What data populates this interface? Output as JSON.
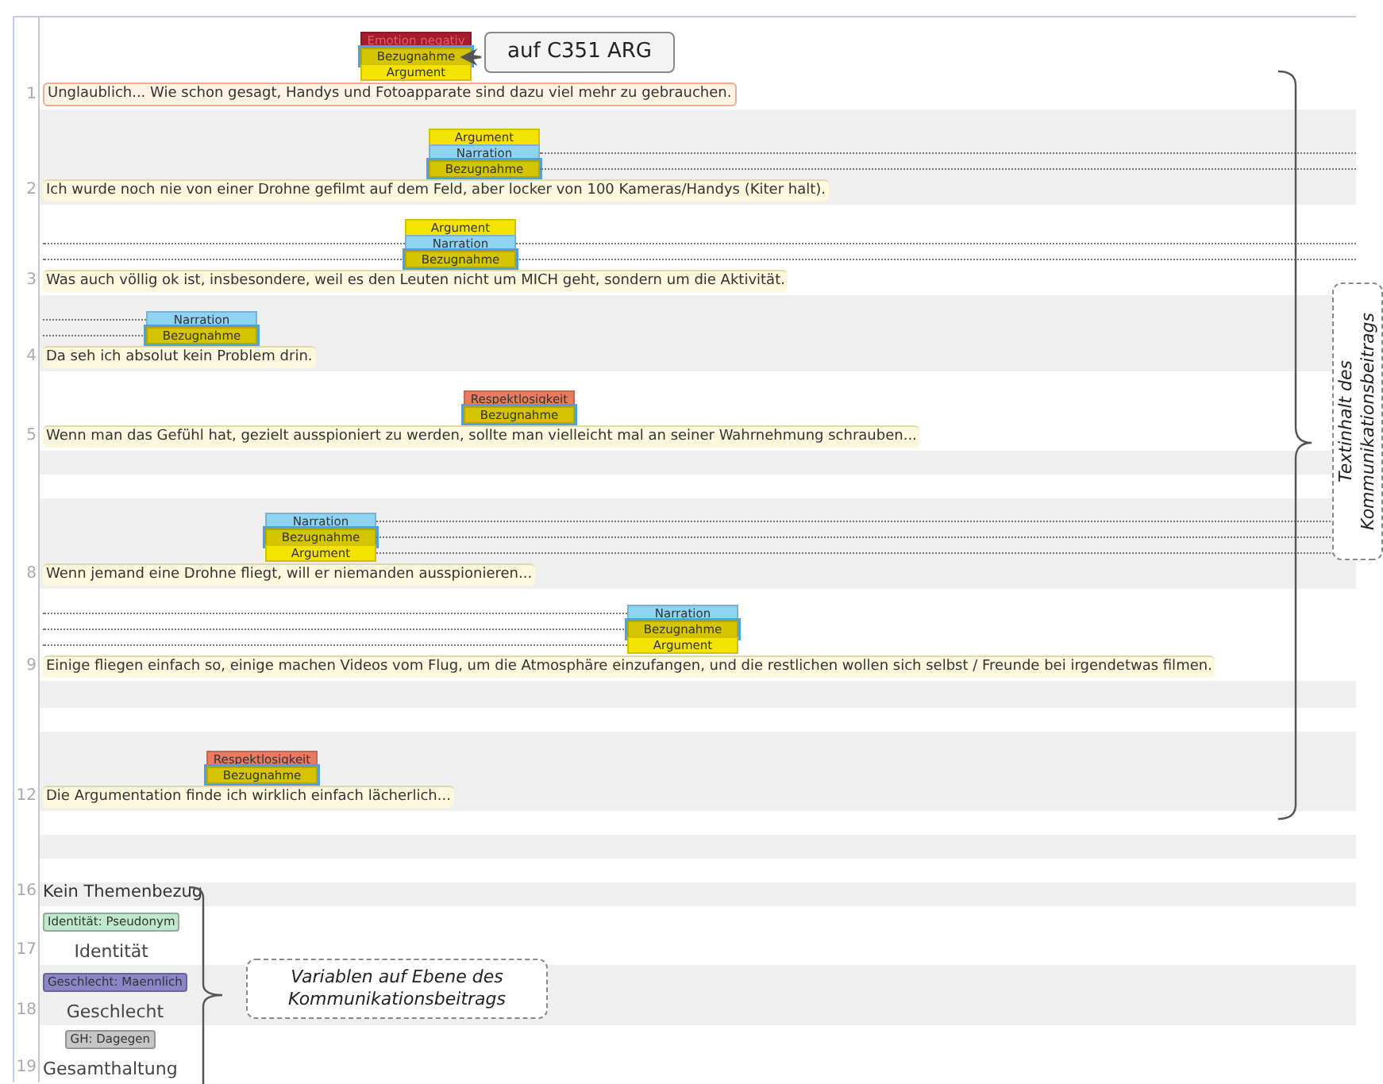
{
  "rows": [
    {
      "kind": "segment",
      "number": "1",
      "coded": true,
      "tags": [
        {
          "label": "Emotion negativ",
          "color": "#a31d2c",
          "selected": false,
          "guide_left": false,
          "guide_right": false
        },
        {
          "label": "Bezugnahme",
          "color": "#d6c400",
          "selected": true,
          "guide_left": false,
          "guide_right": false
        },
        {
          "label": "Argument",
          "color": "#f5e400",
          "selected": false,
          "guide_left": false,
          "guide_right": false
        }
      ],
      "text": "Unglaublich... Wie schon gesagt, Handys und Fotoapparate sind dazu viel mehr zu gebrauchen."
    },
    {
      "kind": "segment",
      "number": "2",
      "coded": true,
      "tags": [
        {
          "label": "Argument",
          "color": "#f5e400",
          "selected": false,
          "guide_left": false,
          "guide_right": false
        },
        {
          "label": "Narration",
          "color": "#8fd3f2",
          "selected": false,
          "guide_left": false,
          "guide_right": true
        },
        {
          "label": "Bezugnahme",
          "color": "#d6c400",
          "selected": true,
          "guide_left": false,
          "guide_right": true
        }
      ],
      "text": "Ich wurde noch nie von einer Drohne gefilmt auf dem Feld, aber locker von 100 Kameras/Handys (Kiter halt)."
    },
    {
      "kind": "segment",
      "number": "3",
      "coded": true,
      "tags": [
        {
          "label": "Argument",
          "color": "#f5e400",
          "selected": false,
          "guide_left": false,
          "guide_right": false
        },
        {
          "label": "Narration",
          "color": "#8fd3f2",
          "selected": false,
          "guide_left": true,
          "guide_right": true
        },
        {
          "label": "Bezugnahme",
          "color": "#d6c400",
          "selected": true,
          "guide_left": true,
          "guide_right": true
        }
      ],
      "text": "Was auch völlig ok ist, insbesondere, weil es den Leuten nicht um MICH geht, sondern um die Aktivität."
    },
    {
      "kind": "segment",
      "number": "4",
      "coded": true,
      "tags": [
        {
          "label": "Narration",
          "color": "#8fd3f2",
          "selected": false,
          "guide_left": true,
          "guide_right": false
        },
        {
          "label": "Bezugnahme",
          "color": "#d6c400",
          "selected": true,
          "guide_left": true,
          "guide_right": false
        }
      ],
      "text": "Da seh ich absolut kein Problem drin."
    },
    {
      "kind": "segment",
      "number": "5",
      "coded": true,
      "tags": [
        {
          "label": "Respektlosigkeit",
          "color": "#ea7a62",
          "selected": false,
          "guide_left": false,
          "guide_right": false
        },
        {
          "label": "Bezugnahme",
          "color": "#d6c400",
          "selected": true,
          "guide_left": false,
          "guide_right": false
        }
      ],
      "text": "Wenn man das Gefühl hat, gezielt ausspioniert zu werden, sollte man vielleicht mal an seiner Wahrnehmung schrauben..."
    },
    {
      "kind": "empty"
    },
    {
      "kind": "empty"
    },
    {
      "kind": "segment",
      "number": "8",
      "coded": true,
      "tags": [
        {
          "label": "Narration",
          "color": "#8fd3f2",
          "selected": false,
          "guide_left": false,
          "guide_right": true
        },
        {
          "label": "Bezugnahme",
          "color": "#d6c400",
          "selected": true,
          "guide_left": false,
          "guide_right": true
        },
        {
          "label": "Argument",
          "color": "#f5e400",
          "selected": false,
          "guide_left": false,
          "guide_right": true
        }
      ],
      "text": "Wenn jemand eine Drohne fliegt, will er niemanden ausspionieren..."
    },
    {
      "kind": "segment",
      "number": "9",
      "coded": true,
      "tags": [
        {
          "label": "Narration",
          "color": "#8fd3f2",
          "selected": false,
          "guide_left": true,
          "guide_right": false
        },
        {
          "label": "Bezugnahme",
          "color": "#d6c400",
          "selected": true,
          "guide_left": true,
          "guide_right": false
        },
        {
          "label": "Argument",
          "color": "#f5e400",
          "selected": false,
          "guide_left": true,
          "guide_right": false
        }
      ],
      "text": "Einige fliegen einfach so, einige machen Videos vom Flug, um die Atmosphäre einzufangen, und die restlichen wollen sich selbst / Freunde bei irgendetwas filmen."
    },
    {
      "kind": "empty"
    },
    {
      "kind": "empty"
    },
    {
      "kind": "segment",
      "number": "12",
      "coded": true,
      "tags": [
        {
          "label": "Respektlosigkeit",
          "color": "#ea7a62",
          "selected": false,
          "guide_left": false,
          "guide_right": false
        },
        {
          "label": "Bezugnahme",
          "color": "#d6c400",
          "selected": true,
          "guide_left": false,
          "guide_right": false
        }
      ],
      "text": "Die Argumentation finde ich wirklich einfach lächerlich..."
    },
    {
      "kind": "empty"
    },
    {
      "kind": "empty"
    },
    {
      "kind": "empty"
    },
    {
      "kind": "plain",
      "number": "16",
      "text": "Kein Themenbezug"
    },
    {
      "kind": "variable",
      "number": "17",
      "chip": {
        "label": "Identität: Pseudonym",
        "color": "#bfe8cc"
      },
      "text": "Identität"
    },
    {
      "kind": "variable",
      "number": "18",
      "chip": {
        "label": "Geschlecht: Maennlich",
        "color": "#8c86c9"
      },
      "text": "Geschlecht"
    },
    {
      "kind": "variable",
      "number": "19",
      "chip": {
        "label": "GH: Dagegen",
        "color": "#c6c6c6"
      },
      "text": "Gesamthaltung"
    }
  ],
  "annotations": [
    {
      "kind": "callout",
      "text": "auf C351 ARG"
    },
    {
      "kind": "brace_note",
      "text": "Textinhalt des Kommunikationsbeitrags"
    },
    {
      "kind": "brace_note",
      "text": "Variablen auf Ebene des Kommunikationsbeitrags"
    }
  ]
}
